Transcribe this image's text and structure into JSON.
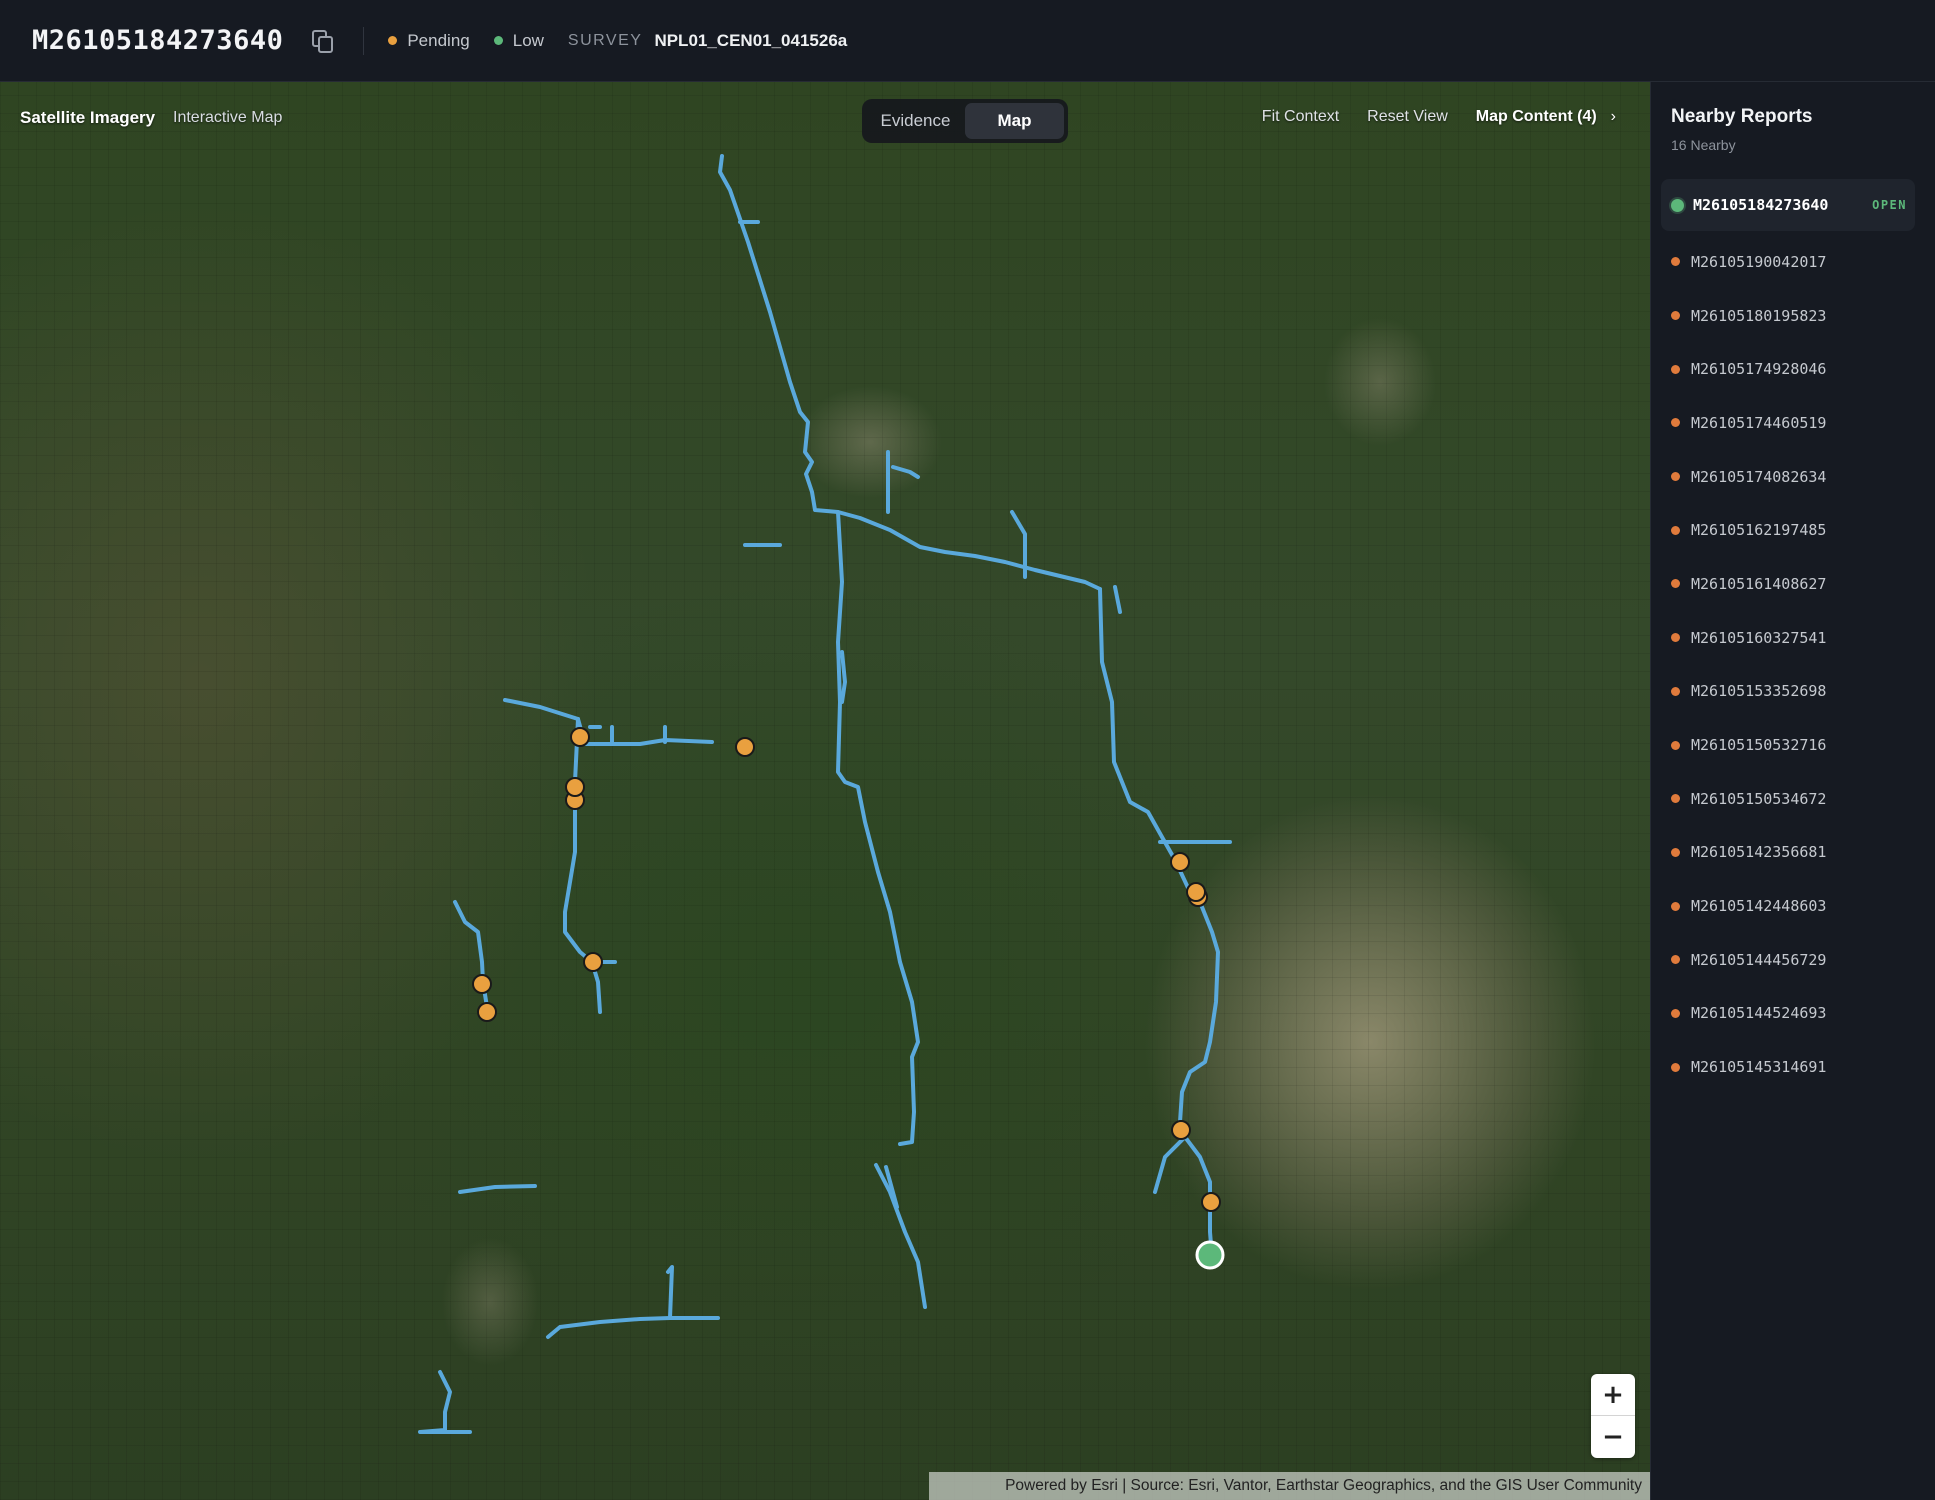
{
  "header": {
    "report_id": "M26105184273640",
    "status": {
      "label": "Pending",
      "color": "#e9a03f"
    },
    "priority": {
      "label": "Low",
      "color": "#5cb87a"
    },
    "survey_label": "SURVEY",
    "survey_value": "NPL01_CEN01_041526a"
  },
  "map": {
    "title": "Satellite Imagery",
    "subtitle": "Interactive Map",
    "tabs": [
      {
        "label": "Evidence",
        "active": false
      },
      {
        "label": "Map",
        "active": true
      }
    ],
    "actions": {
      "fit_context": "Fit Context",
      "reset_view": "Reset View",
      "map_content": "Map Content (4)"
    },
    "zoom_in": "+",
    "zoom_out": "−",
    "attribution": "Powered by Esri | Source: Esri, Vantor, Earthstar Geographics, and the GIS User Community",
    "line_color": "#5aa9dc",
    "marker_color": "#e9a03f",
    "selected_marker_color": "#5cb87a"
  },
  "sidebar": {
    "title": "Nearby Reports",
    "count": "16 Nearby",
    "open_label": "OPEN",
    "items": [
      {
        "id": "M26105184273640",
        "active": true
      },
      {
        "id": "M26105190042017",
        "active": false
      },
      {
        "id": "M26105180195823",
        "active": false
      },
      {
        "id": "M26105174928046",
        "active": false
      },
      {
        "id": "M26105174460519",
        "active": false
      },
      {
        "id": "M26105174082634",
        "active": false
      },
      {
        "id": "M26105162197485",
        "active": false
      },
      {
        "id": "M26105161408627",
        "active": false
      },
      {
        "id": "M26105160327541",
        "active": false
      },
      {
        "id": "M26105153352698",
        "active": false
      },
      {
        "id": "M26105150532716",
        "active": false
      },
      {
        "id": "M26105150534672",
        "active": false
      },
      {
        "id": "M26105142356681",
        "active": false
      },
      {
        "id": "M26105142448603",
        "active": false
      },
      {
        "id": "M26105144456729",
        "active": false
      },
      {
        "id": "M26105144524693",
        "active": false
      },
      {
        "id": "M26105145314691",
        "active": false
      }
    ]
  }
}
